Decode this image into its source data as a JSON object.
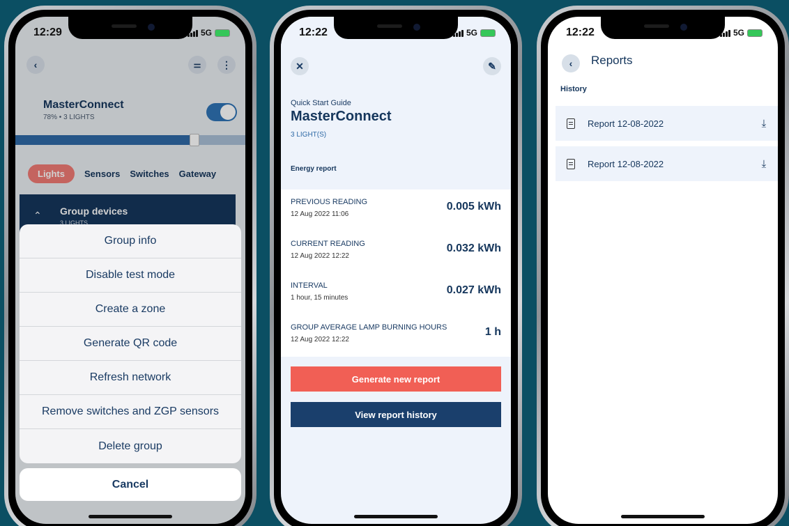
{
  "phone1": {
    "time": "12:29",
    "network": "5G",
    "title": "MasterConnect",
    "subtitle": "78% • 3 LIGHTS",
    "brightness": 0.78,
    "tabs": [
      "Lights",
      "Sensors",
      "Switches",
      "Gateway"
    ],
    "group_title": "Group devices",
    "group_sub": "3 LIGHTS",
    "menu": [
      "Group info",
      "Disable test mode",
      "Create a zone",
      "Generate QR code",
      "Refresh network",
      "Remove switches and ZGP sensors",
      "Delete group"
    ],
    "cancel": "Cancel"
  },
  "phone2": {
    "time": "12:22",
    "network": "5G",
    "kicker": "Quick Start Guide",
    "title": "MasterConnect",
    "lights": "3 LIGHT(S)",
    "section": "Energy report",
    "readings": [
      {
        "label": "PREVIOUS READING",
        "date": "12 Aug 2022  11:06",
        "value": "0.005 kWh"
      },
      {
        "label": "CURRENT READING",
        "date": "12 Aug 2022  12:22",
        "value": "0.032 kWh"
      },
      {
        "label": "INTERVAL",
        "date": "1 hour, 15 minutes",
        "value": "0.027 kWh"
      },
      {
        "label": "GROUP AVERAGE LAMP BURNING HOURS",
        "date": "12 Aug 2022  12:22",
        "value": "1 h"
      }
    ],
    "generate_btn": "Generate new report",
    "history_btn": "View report history"
  },
  "phone3": {
    "time": "12:22",
    "network": "5G",
    "title": "Reports",
    "section": "History",
    "reports": [
      "Report 12-08-2022",
      "Report 12-08-2022"
    ]
  },
  "colors": {
    "navy": "#15365c",
    "accent_red": "#f15f55",
    "background": "#0b4f63"
  }
}
